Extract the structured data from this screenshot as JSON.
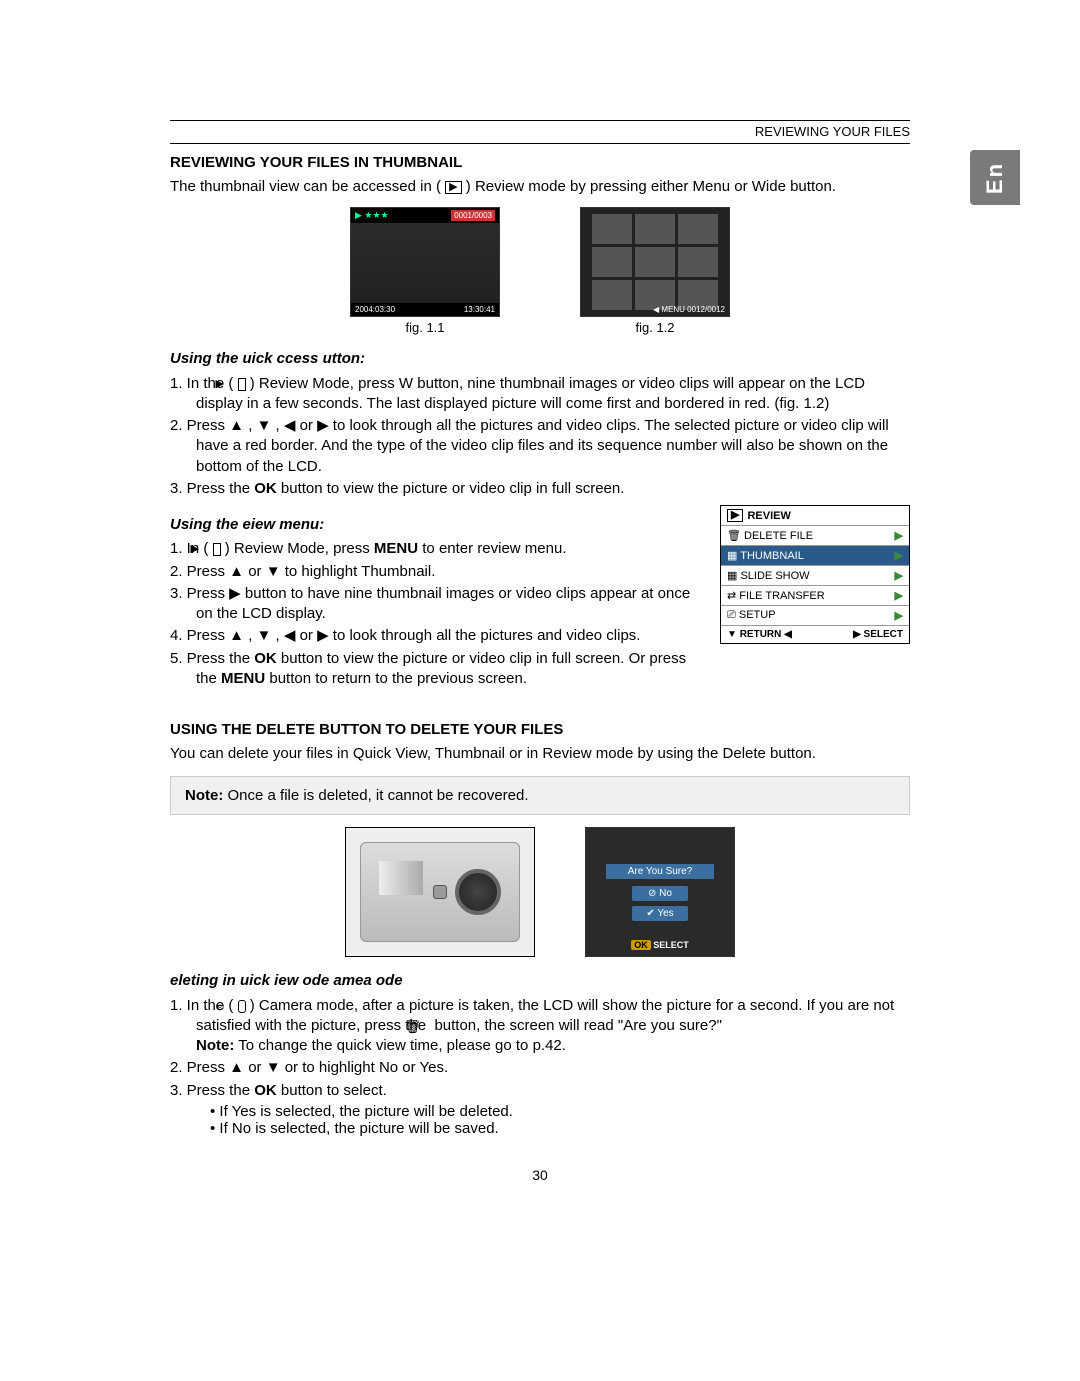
{
  "header": {
    "section_ref": "REVIEWING YOUR FILES"
  },
  "side_tab": "En",
  "s1": {
    "heading": "REVIEWING YOUR FILES IN THUMBNAIL",
    "intro_a": "The thumbnail view can be accessed in ( ",
    "intro_b": " ) Review mode by pressing either Menu or Wide button.",
    "fig1": {
      "caption": "fig. 1.1",
      "top_left": "▶  ★★★",
      "top_right": "0001/0003",
      "bot_left": "2004:03:30",
      "bot_right": "13:30:41"
    },
    "fig2": {
      "caption": "fig. 1.2",
      "bot": "◀ MENU  0012/0012"
    },
    "quick": {
      "heading": "Using the uick ccess utton:",
      "li1_a": "1.  In the ( ",
      "li1_b": " ) Review Mode, press W button, nine thumbnail images or video clips will appear on the LCD display in a few seconds. The last displayed picture will come first and bordered in red. (fig. 1.2)",
      "li2_a": "2.  Press ▲  , ▼  , ◀  or ▶  to look through all the pictures and video clips. The selected picture or video clip will have a red border. And the type of the video clip files and its sequence number will also be shown on the bottom of the LCD.",
      "li3_a": "3.  Press the ",
      "li3_b": "OK",
      "li3_c": " button to view the picture or video clip in full screen."
    },
    "eiew": {
      "heading": "Using the eiew menu:",
      "li1_a": "1.  In ( ",
      "li1_b": " ) Review Mode, press ",
      "li1_c": "MENU",
      "li1_d": " to enter review menu.",
      "li2": "2.  Press ▲ or ▼  to highlight Thumbnail.",
      "li3": "3.  Press ▶  button to have nine thumbnail images or video clips appear at once on the LCD display.",
      "li4": "4.  Press ▲  , ▼  , ◀  or ▶  to look through all the pictures and video clips.",
      "li5_a": "5.  Press the ",
      "li5_b": "OK",
      "li5_c": " button to view the picture or video clip in full screen. Or press the ",
      "li5_d": "MENU",
      "li5_e": " button to return to the previous screen."
    },
    "menubox": {
      "title": "REVIEW",
      "items": [
        "DELETE FILE",
        "THUMBNAIL",
        "SLIDE SHOW",
        "FILE TRANSFER",
        "SETUP"
      ],
      "foot_left": "RETURN",
      "foot_right": "SELECT"
    }
  },
  "s2": {
    "heading": "USING THE DELETE BUTTON TO DELETE YOUR FILES",
    "intro": "You can delete your files in Quick View, Thumbnail or in Review mode by using the Delete button.",
    "note_label": "Note:",
    "note_text": " Once a file is deleted, it cannot be recovered.",
    "lcd": {
      "prompt": "Are You Sure?",
      "no": "⊘ No",
      "yes": "✔ Yes",
      "select": "SELECT",
      "ok": "OK"
    },
    "del": {
      "heading": "eleting in uick iew ode amea ode",
      "li1_a": "1.  In the ( ",
      "li1_b": " ) Camera mode, after a picture is taken, the LCD will show the picture for a second. If you are not satisfied with the picture, press the ",
      "li1_c": " button, the screen will read \"Are you sure?\"",
      "li1_note_label": "Note:",
      "li1_note_text": " To change the quick view time, please go to p.42.",
      "li2": "2.  Press ▲  or ▼  or to highlight No or Yes.",
      "li3_a": "3.  Press the ",
      "li3_b": "OK",
      "li3_c": " button to select.",
      "b1": "If Yes is selected, the picture will be deleted.",
      "b2": "If No is selected, the picture will be saved."
    }
  },
  "page_number": "30"
}
